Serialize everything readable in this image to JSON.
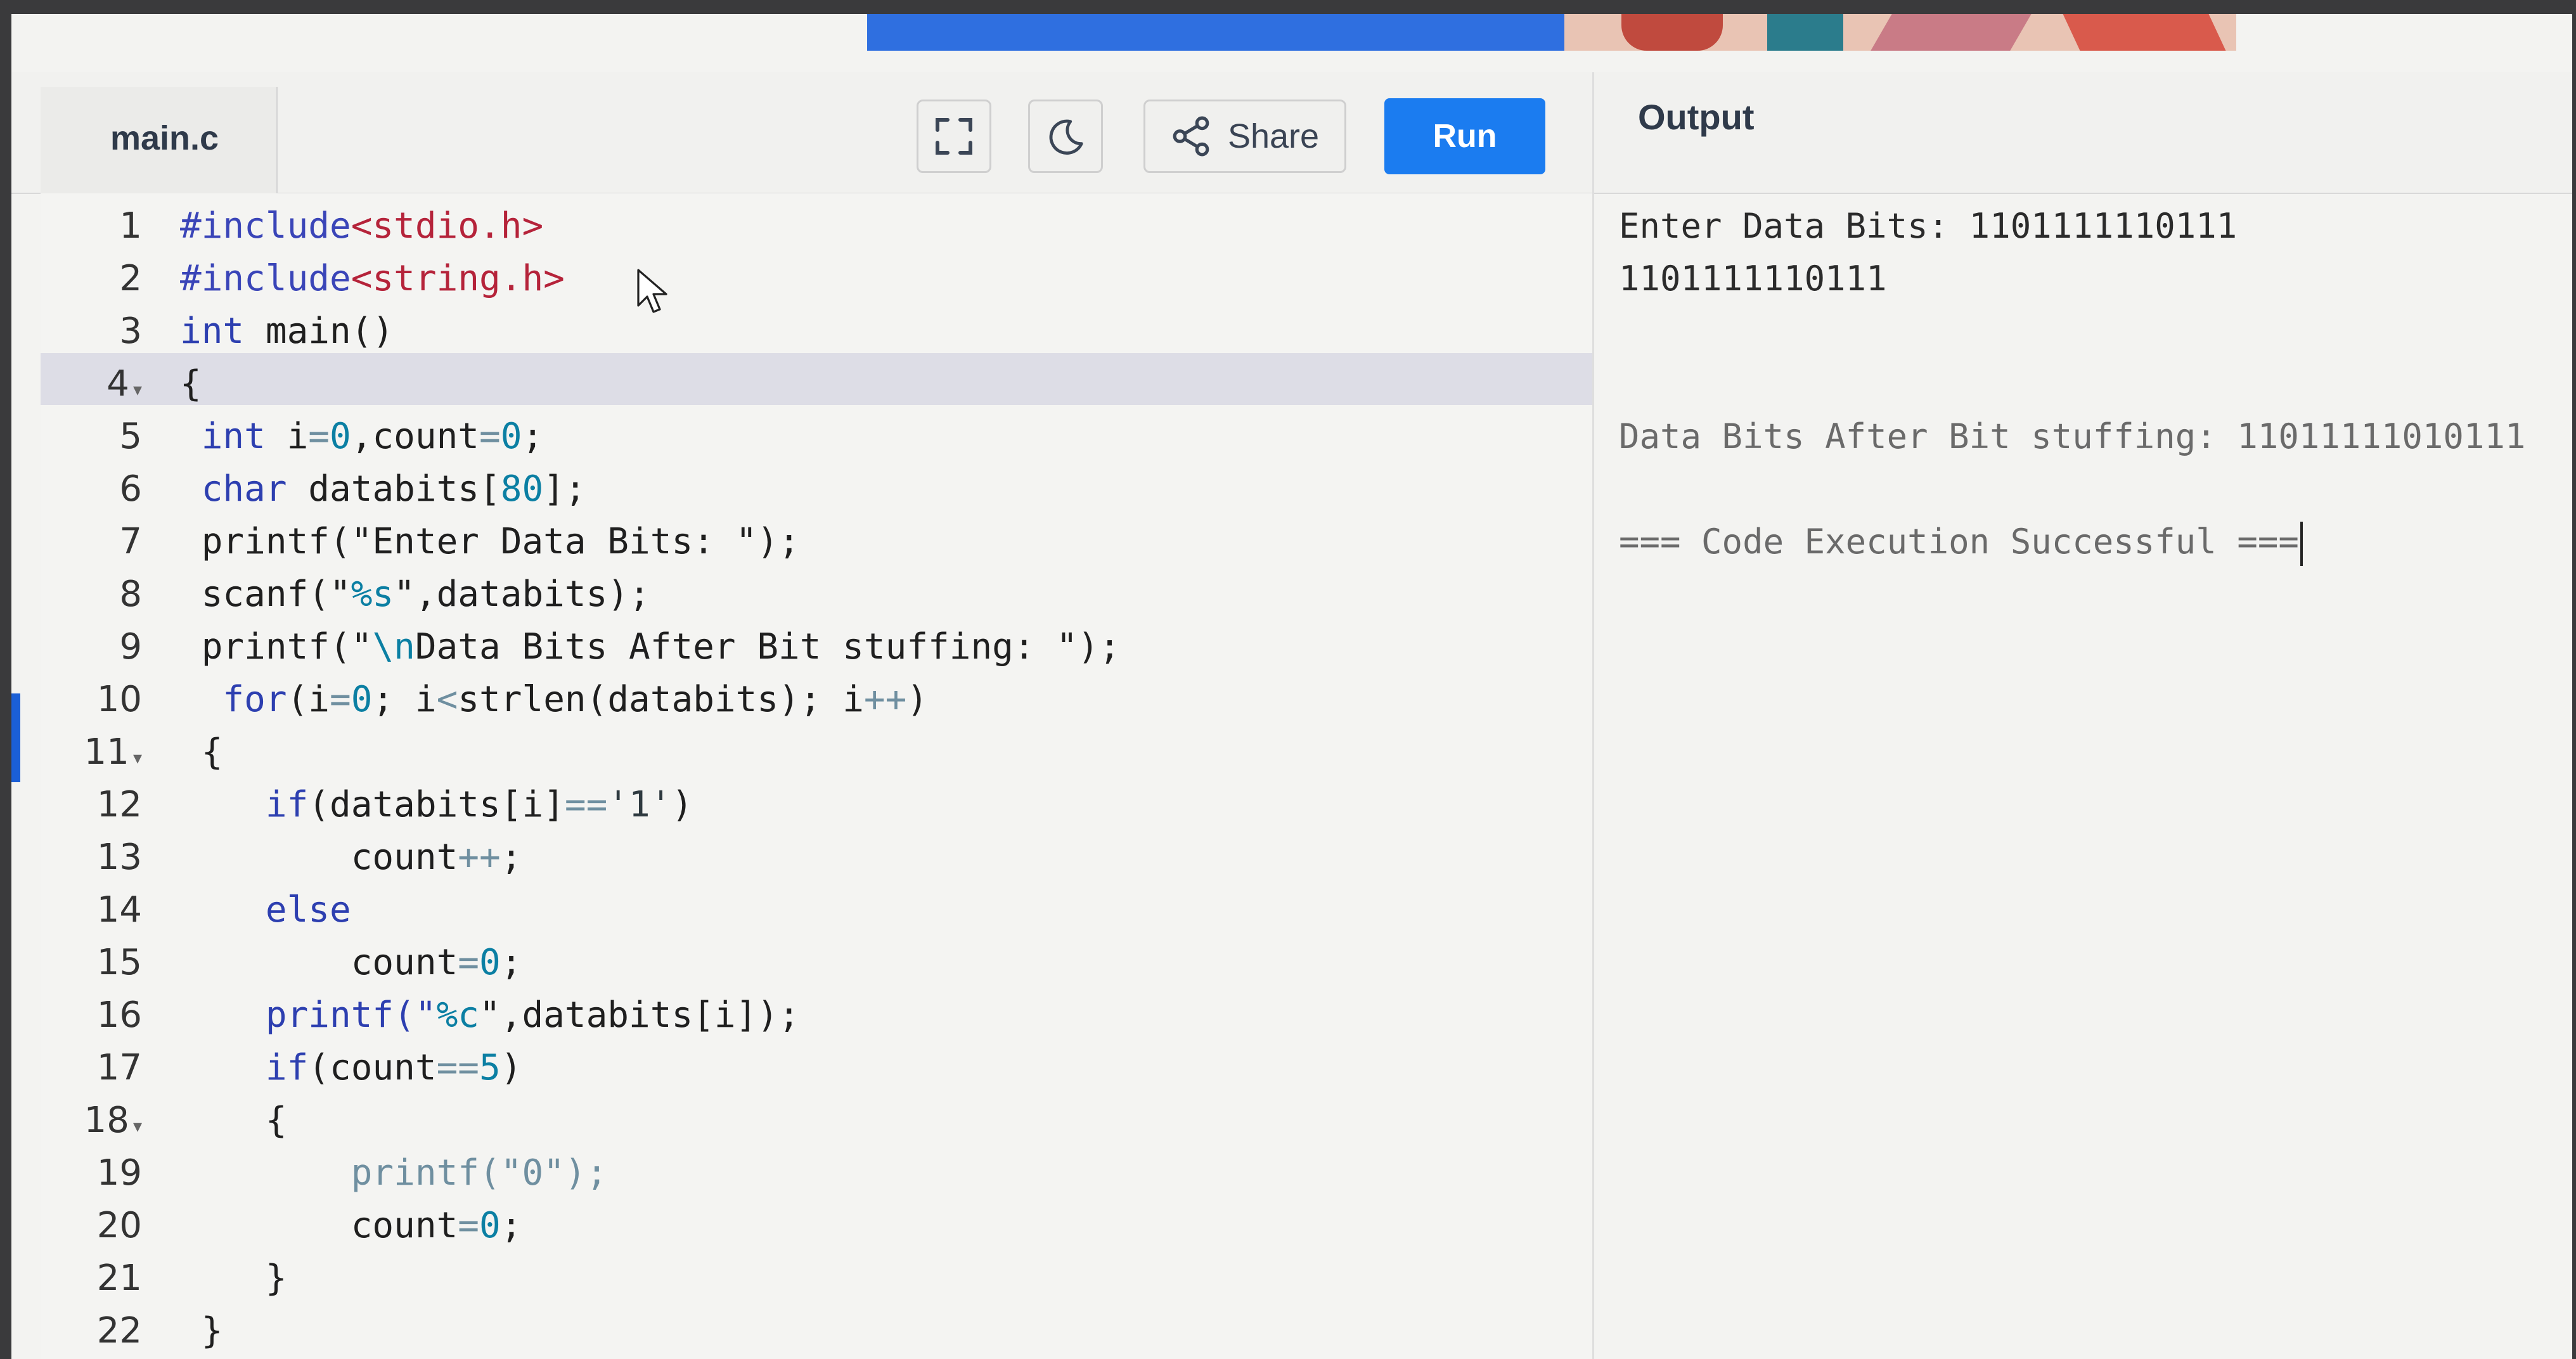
{
  "editor": {
    "file_tab": "main.c",
    "lines": [
      {
        "n": "1",
        "fold": false,
        "segments": [
          {
            "t": "#include",
            "c": "inc"
          },
          {
            "t": "<stdio.h>",
            "c": "hdr"
          }
        ]
      },
      {
        "n": "2",
        "fold": false,
        "segments": [
          {
            "t": "#include",
            "c": "inc"
          },
          {
            "t": "<string.h>",
            "c": "hdr"
          }
        ]
      },
      {
        "n": "3",
        "fold": false,
        "segments": [
          {
            "t": "int",
            "c": "kw"
          },
          {
            "t": " main()",
            "c": "plain"
          }
        ]
      },
      {
        "n": "4",
        "fold": true,
        "segments": [
          {
            "t": "{",
            "c": "plain"
          }
        ]
      },
      {
        "n": "5",
        "fold": false,
        "segments": [
          {
            "t": " int",
            "c": "kw"
          },
          {
            "t": " i",
            "c": "plain"
          },
          {
            "t": "=",
            "c": "op"
          },
          {
            "t": "0",
            "c": "num"
          },
          {
            "t": ",count",
            "c": "plain"
          },
          {
            "t": "=",
            "c": "op"
          },
          {
            "t": "0",
            "c": "num"
          },
          {
            "t": ";",
            "c": "plain"
          }
        ]
      },
      {
        "n": "6",
        "fold": false,
        "segments": [
          {
            "t": " char",
            "c": "kw"
          },
          {
            "t": " databits[",
            "c": "plain"
          },
          {
            "t": "80",
            "c": "num"
          },
          {
            "t": "];",
            "c": "plain"
          }
        ]
      },
      {
        "n": "7",
        "fold": false,
        "segments": [
          {
            "t": " printf(\"Enter Data Bits: \");",
            "c": "plain"
          }
        ]
      },
      {
        "n": "8",
        "fold": false,
        "segments": [
          {
            "t": " scanf(\"",
            "c": "plain"
          },
          {
            "t": "%s",
            "c": "num"
          },
          {
            "t": "\",databits);",
            "c": "plain"
          }
        ]
      },
      {
        "n": "9",
        "fold": false,
        "segments": [
          {
            "t": " printf(\"",
            "c": "plain"
          },
          {
            "t": "\\n",
            "c": "num"
          },
          {
            "t": "Data Bits After Bit stuffing: \");",
            "c": "plain"
          }
        ]
      },
      {
        "n": "10",
        "fold": false,
        "segments": [
          {
            "t": "  for",
            "c": "kw"
          },
          {
            "t": "(i",
            "c": "plain"
          },
          {
            "t": "=",
            "c": "op"
          },
          {
            "t": "0",
            "c": "num"
          },
          {
            "t": "; i",
            "c": "plain"
          },
          {
            "t": "<",
            "c": "op"
          },
          {
            "t": "strlen(databits); i",
            "c": "plain"
          },
          {
            "t": "++",
            "c": "op"
          },
          {
            "t": ")",
            "c": "plain"
          }
        ]
      },
      {
        "n": "11",
        "fold": true,
        "segments": [
          {
            "t": " {",
            "c": "plain"
          }
        ]
      },
      {
        "n": "12",
        "fold": false,
        "segments": [
          {
            "t": "    if",
            "c": "kw"
          },
          {
            "t": "(databits[i]",
            "c": "plain"
          },
          {
            "t": "==",
            "c": "op"
          },
          {
            "t": "'1'",
            "c": "str"
          },
          {
            "t": ")",
            "c": "plain"
          }
        ]
      },
      {
        "n": "13",
        "fold": false,
        "segments": [
          {
            "t": "        count",
            "c": "plain"
          },
          {
            "t": "++",
            "c": "op"
          },
          {
            "t": ";",
            "c": "plain"
          }
        ]
      },
      {
        "n": "14",
        "fold": false,
        "segments": [
          {
            "t": "    else",
            "c": "kw"
          }
        ]
      },
      {
        "n": "15",
        "fold": false,
        "segments": [
          {
            "t": "        count",
            "c": "plain"
          },
          {
            "t": "=",
            "c": "op"
          },
          {
            "t": "0",
            "c": "num"
          },
          {
            "t": ";",
            "c": "plain"
          }
        ]
      },
      {
        "n": "16",
        "fold": false,
        "segments": [
          {
            "t": "    printf(\"",
            "c": "kw"
          },
          {
            "t": "%c",
            "c": "num"
          },
          {
            "t": "\",databits[i]);",
            "c": "plain"
          }
        ]
      },
      {
        "n": "17",
        "fold": false,
        "segments": [
          {
            "t": "    if",
            "c": "kw"
          },
          {
            "t": "(count",
            "c": "plain"
          },
          {
            "t": "==",
            "c": "op"
          },
          {
            "t": "5",
            "c": "num"
          },
          {
            "t": ")",
            "c": "plain"
          }
        ]
      },
      {
        "n": "18",
        "fold": true,
        "segments": [
          {
            "t": "    {",
            "c": "plain"
          }
        ]
      },
      {
        "n": "19",
        "fold": false,
        "segments": [
          {
            "t": "        printf(\"0\");",
            "c": "op"
          }
        ]
      },
      {
        "n": "20",
        "fold": false,
        "segments": [
          {
            "t": "        count",
            "c": "plain"
          },
          {
            "t": "=",
            "c": "op"
          },
          {
            "t": "0",
            "c": "num"
          },
          {
            "t": ";",
            "c": "plain"
          }
        ]
      },
      {
        "n": "21",
        "fold": false,
        "segments": [
          {
            "t": "    }",
            "c": "plain"
          }
        ]
      },
      {
        "n": "22",
        "fold": false,
        "segments": [
          {
            "t": " }",
            "c": "plain"
          }
        ]
      }
    ]
  },
  "toolbar": {
    "fullscreen_icon": "fullscreen-icon",
    "theme_icon": "moon-icon",
    "share_icon": "share-icon",
    "share_label": "Share",
    "run_label": "Run",
    "run_color": "#1b7cf0"
  },
  "output": {
    "title": "Output",
    "lines": [
      {
        "text": "Enter Data Bits: 1101111110111",
        "muted": false
      },
      {
        "text": "1101111110111",
        "muted": false
      },
      {
        "text": "",
        "muted": false
      },
      {
        "text": "",
        "muted": false
      },
      {
        "text": "Data Bits After Bit stuffing: 11011111010111",
        "muted": true
      },
      {
        "text": "",
        "muted": false
      },
      {
        "text": "=== Code Execution Successful ===",
        "muted": true
      }
    ]
  }
}
